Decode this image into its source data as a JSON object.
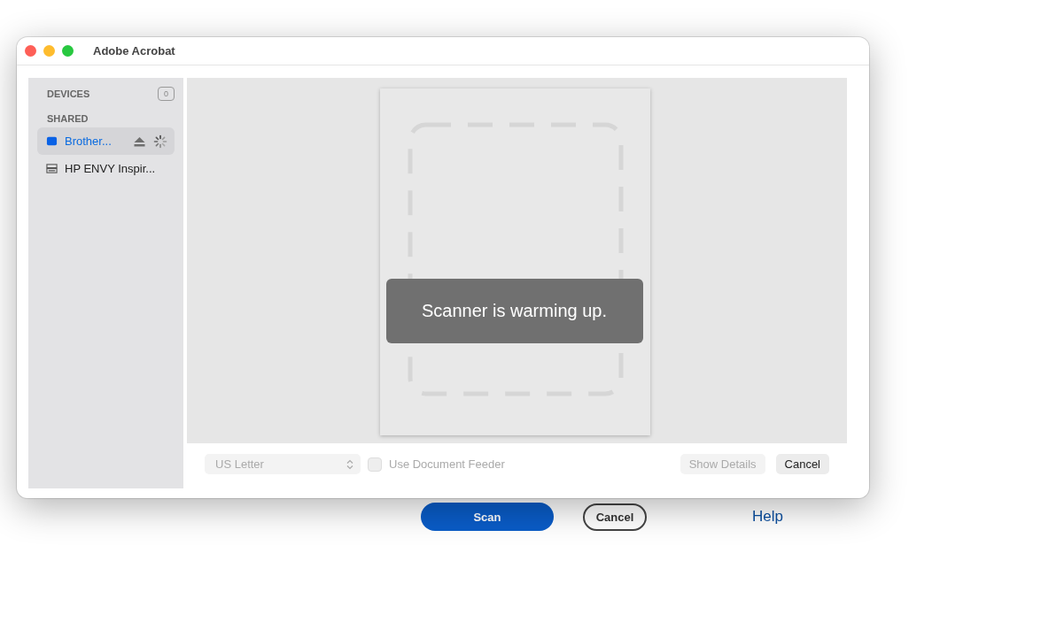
{
  "page": {
    "buttons": [
      {
        "label": "Scan",
        "kind": "primary"
      },
      {
        "label": "Cancel",
        "kind": "outline"
      },
      {
        "label": "Help",
        "kind": "link"
      }
    ]
  },
  "window": {
    "title": "Adobe Acrobat"
  },
  "sidebar": {
    "devices_header": "DEVICES",
    "devices_count": "0",
    "shared_header": "SHARED",
    "items": [
      {
        "name": "Brother...",
        "selected": true,
        "busy": true,
        "kind": "printer"
      },
      {
        "name": "HP ENVY Inspir...",
        "selected": false,
        "busy": false,
        "kind": "scanner"
      }
    ]
  },
  "preview": {
    "message": "Scanner is warming up."
  },
  "footer": {
    "paper_size": {
      "value": "US Letter",
      "disabled": true
    },
    "feeder": {
      "label": "Use Document Feeder",
      "checked": false,
      "disabled": true
    },
    "show_details": {
      "label": "Show Details",
      "disabled": true
    },
    "cancel": {
      "label": "Cancel",
      "disabled": false
    }
  }
}
